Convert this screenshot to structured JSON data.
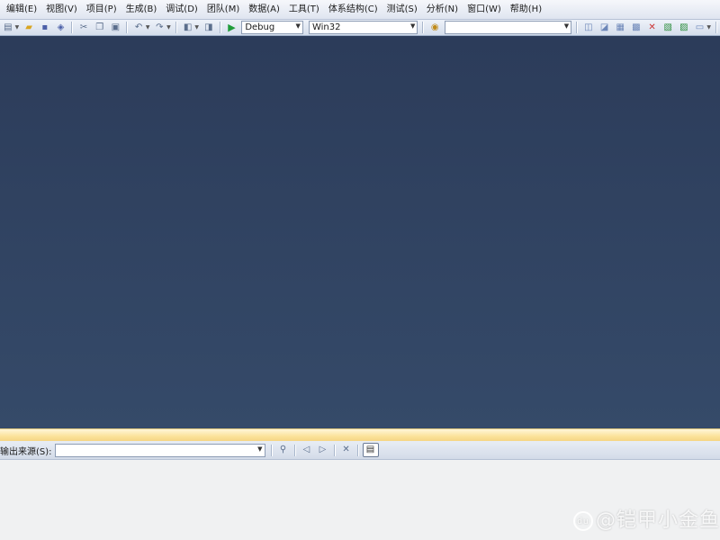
{
  "menubar": {
    "items": [
      {
        "label": "编辑(E)"
      },
      {
        "label": "视图(V)"
      },
      {
        "label": "项目(P)"
      },
      {
        "label": "生成(B)"
      },
      {
        "label": "调试(D)"
      },
      {
        "label": "团队(M)"
      },
      {
        "label": "数据(A)"
      },
      {
        "label": "工具(T)"
      },
      {
        "label": "体系结构(C)"
      },
      {
        "label": "测试(S)"
      },
      {
        "label": "分析(N)"
      },
      {
        "label": "窗口(W)"
      },
      {
        "label": "帮助(H)"
      }
    ]
  },
  "toolbar": {
    "configuration": "Debug",
    "platform": "Win32",
    "find_value": ""
  },
  "output": {
    "source_label": "输出来源(S):",
    "source_value": ""
  },
  "watermark": {
    "badge": "du",
    "text": "@铠甲小金鱼"
  }
}
